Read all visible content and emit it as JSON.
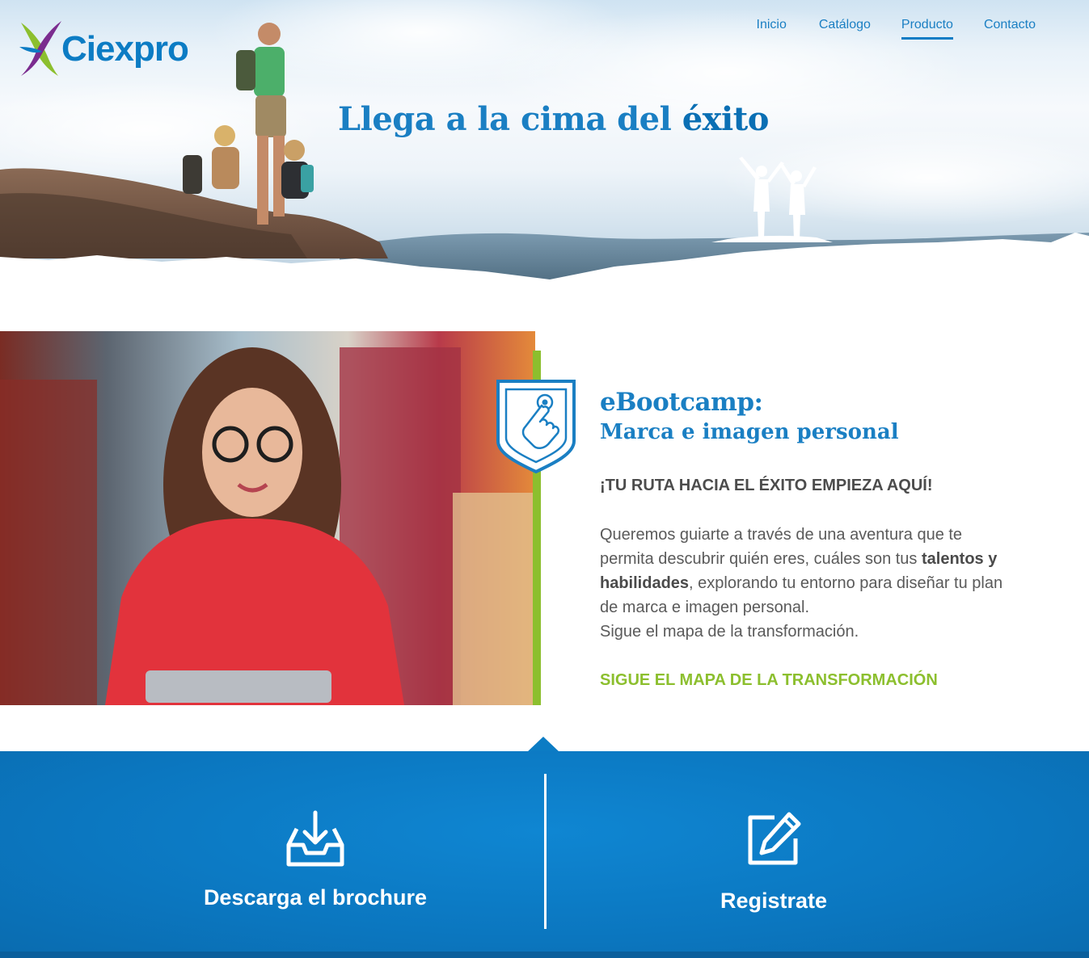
{
  "brand": {
    "name": "Ciexpro"
  },
  "nav": {
    "items": [
      {
        "label": "Inicio"
      },
      {
        "label": "Catálogo"
      },
      {
        "label": "Producto",
        "active": true
      },
      {
        "label": "Contacto"
      }
    ]
  },
  "hero": {
    "title_regular": "Llega a la cima del ",
    "title_bold": "éxito"
  },
  "product": {
    "title": "eBootcamp:",
    "subtitle": "Marca e imagen personal",
    "badge_icon": "touch-hand-icon",
    "headline": "¡TU RUTA HACIA EL ÉXITO EMPIEZA AQUÍ!",
    "description_part1": "Queremos guiarte a través de una aventura que te permita descubrir quién eres, cuáles son tus ",
    "description_bold": "talentos y habilidades",
    "description_part2": ", explorando tu entorno para diseñar tu plan de marca e imagen personal.",
    "description_part3": "Sigue el mapa de la transformación.",
    "cta": "SIGUE EL MAPA DE LA TRANSFORMACIÓN"
  },
  "footer": {
    "download": {
      "label": "Descarga el brochure",
      "icon": "download-tray-icon"
    },
    "register": {
      "label": "Registrate",
      "icon": "edit-icon"
    }
  },
  "colors": {
    "primary": "#0c7cc4",
    "accent_green": "#8cbf2e",
    "text": "#5a5a5a",
    "footer_bg": "#0b77c0"
  }
}
